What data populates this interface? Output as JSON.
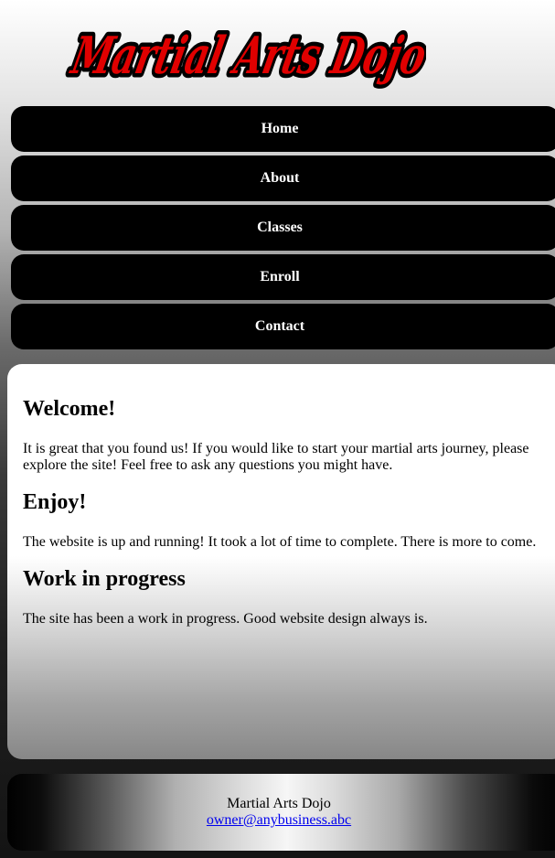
{
  "header": {
    "logo_text": "Martial Arts Dojo",
    "logo_color": "#e00000"
  },
  "nav": {
    "items": [
      {
        "label": "Home"
      },
      {
        "label": "About"
      },
      {
        "label": "Classes"
      },
      {
        "label": "Enroll"
      },
      {
        "label": "Contact"
      }
    ]
  },
  "main": {
    "sections": [
      {
        "heading": "Welcome!",
        "body": "It is great that you found us! If you would like to start your martial arts journey, please explore the site! Feel free to ask any questions you might have."
      },
      {
        "heading": "Enjoy!",
        "body": "The website is up and running! It took a lot of time to complete. There is more to come."
      },
      {
        "heading": "Work in progress",
        "body": "The site has been a work in progress. Good website design always is."
      }
    ]
  },
  "footer": {
    "name": "Martial Arts Dojo",
    "email": "owner@anybusiness.abc"
  }
}
